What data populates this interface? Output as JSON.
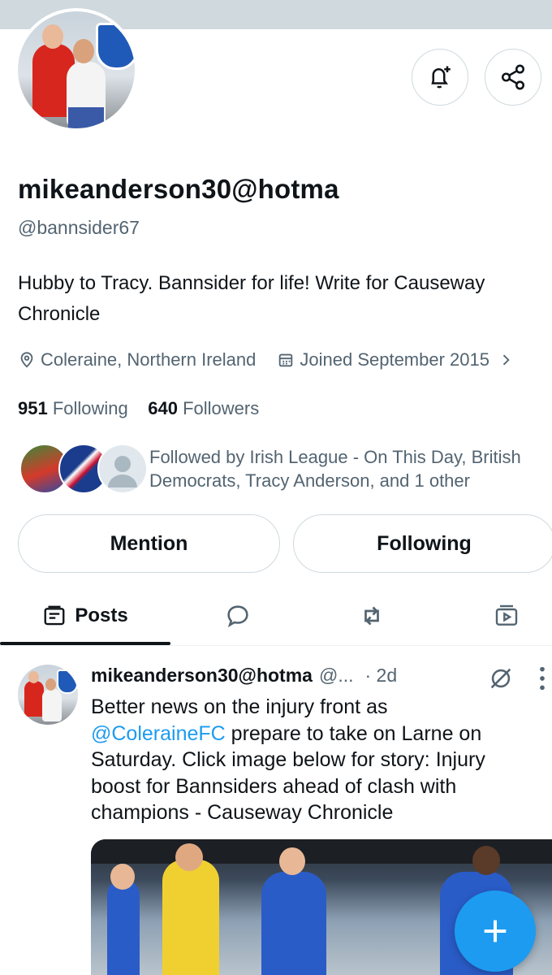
{
  "profile": {
    "display_name": "mikeanderson30@hotma",
    "handle": "@bannsider67",
    "bio": "Hubby to Tracy. Bannsider for life! Write for Causeway Chronicle",
    "location": "Coleraine, Northern Ireland",
    "joined": "Joined September 2015",
    "following_count": "951",
    "following_label": "Following",
    "followers_count": "640",
    "followers_label": "Followers",
    "followed_by_line1": "Followed by Irish League - On This Day, British",
    "followed_by_line2": "Democrats, Tracy Anderson, and 1 other"
  },
  "actions": {
    "mention_label": "Mention",
    "following_label": "Following"
  },
  "tabs": [
    {
      "label": "Posts",
      "icon": "posts-icon"
    },
    {
      "label": "",
      "icon": "replies-icon"
    },
    {
      "label": "",
      "icon": "reposts-icon"
    },
    {
      "label": "",
      "icon": "media-icon"
    }
  ],
  "post": {
    "author": "mikeanderson30@hotma",
    "handle": "@...",
    "time": "· 2d",
    "text_line1": "Better news on the injury front as",
    "mention": "@ColeraineFC",
    "text_line2_rest": " prepare to take on Larne on",
    "text_rest": "Saturday. Click image below for story: Injury boost for Bannsiders ahead of clash with champions - Causeway Chronicle"
  },
  "colors": {
    "accent": "#1d9bf0",
    "text_primary": "#0f1419",
    "text_secondary": "#536471",
    "border": "#cfd9de"
  }
}
